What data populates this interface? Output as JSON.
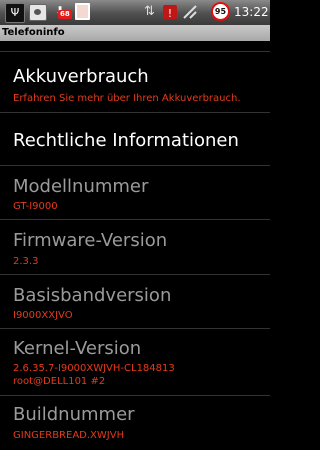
{
  "status_bar": {
    "time": "13:22",
    "battery_level": "95",
    "badge_count": "68",
    "icons": [
      "usb-icon",
      "photo-icon",
      "download-icon",
      "mail-icon",
      "network-icon",
      "alert-icon",
      "signal-icon",
      "battery-icon"
    ]
  },
  "header": {
    "title": "Telefoninfo"
  },
  "items": [
    {
      "title": "Akkuverbrauch",
      "summary": "Erfahren Sie mehr über Ihren Akkuverbrauch."
    },
    {
      "title": "Rechtliche Informationen",
      "summary": ""
    },
    {
      "title": "Modellnummer",
      "summary": "GT-I9000"
    },
    {
      "title": "Firmware-Version",
      "summary": "2.3.3"
    },
    {
      "title": "Basisbandversion",
      "summary": "I9000XXJVO"
    },
    {
      "title": "Kernel-Version",
      "summary": "2.6.35.7-I9000XWJVH-CL184813",
      "summary2": "root@DELL101 #2"
    },
    {
      "title": "Buildnummer",
      "summary": "GINGERBREAD.XWJVH"
    }
  ],
  "colors": {
    "summary": "#e53a1a",
    "title_active": "#ffffff",
    "title_inactive": "#9b9b9b",
    "background": "#000000"
  }
}
